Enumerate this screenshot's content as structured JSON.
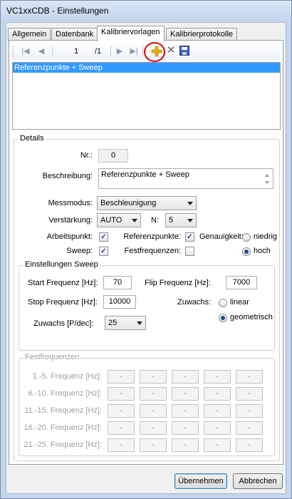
{
  "window": {
    "title": "VC1xxCDB - Einstellungen"
  },
  "tabs": [
    {
      "label": "Allgemein"
    },
    {
      "label": "Datenbank"
    },
    {
      "label": "Kalibriervorlagen"
    },
    {
      "label": "Kalibrierprotokolle"
    }
  ],
  "navigator": {
    "position": "1",
    "count": "/1"
  },
  "list": {
    "items": [
      "Referenzpunkte + Sweep"
    ]
  },
  "details": {
    "legend": "Details",
    "nr_label": "Nr.:",
    "nr_value": "0",
    "beschreibung_label": "Beschreibung:",
    "beschreibung_value": "Referenzpunkte + Sweep",
    "messmodus_label": "Messmodus:",
    "messmodus_value": "Beschleunigung",
    "verstaerkung_label": "Verstärkung:",
    "verstaerkung_value": "AUTO",
    "n_label": "N:",
    "n_value": "5",
    "arbeitspunkt_label": "Arbeitspunkt:",
    "arbeitspunkt_checked": true,
    "referenzpunkte_label": "Referenzpunkte:",
    "referenzpunkte_checked": true,
    "sweep_label": "Sweep:",
    "sweep_checked": true,
    "festfrequenzen_label": "Festfrequenzen:",
    "festfrequenzen_checked": false,
    "genauigkeit_label": "Genauigkeit:",
    "genauigkeit_options": [
      "niedrig",
      "hoch"
    ],
    "genauigkeit_selected": "hoch"
  },
  "sweep": {
    "legend": "Einstellungen Sweep",
    "start_label": "Start Frequenz [Hz]:",
    "start_value": "70",
    "flip_label": "Flip Frequenz [Hz]:",
    "flip_value": "7000",
    "stop_label": "Stop Frequenz [Hz]:",
    "stop_value": "10000",
    "zuwachs_label": "Zuwachs:",
    "zuwachs_options": [
      "linear",
      "geometrisch"
    ],
    "zuwachs_selected": "geometrisch",
    "pdec_label": "Zuwachs [P/dec]:",
    "pdec_value": "25"
  },
  "festfrequenzen": {
    "legend": "Festfrequenzen",
    "rows": [
      "1.-5. Frequenz [Hz]:",
      "6.-10. Frequenz [Hz]:",
      "11.-15. Frequenz [Hz]:",
      "16.-20. Frequenz [Hz]:",
      "21.-25. Frequenz [Hz]:"
    ],
    "cell_value": "-"
  },
  "buttons": {
    "ok": "Übernehmen",
    "cancel": "Abbrechen"
  },
  "icons": {
    "first": "first-record-icon",
    "prev": "previous-record-icon",
    "next": "next-record-icon",
    "last": "last-record-icon",
    "add": "add-icon",
    "delete": "delete-icon",
    "save": "save-icon"
  },
  "colors": {
    "selection": "#3399ff",
    "highlight_circle": "#e00000",
    "add_icon": "#f0b000"
  }
}
